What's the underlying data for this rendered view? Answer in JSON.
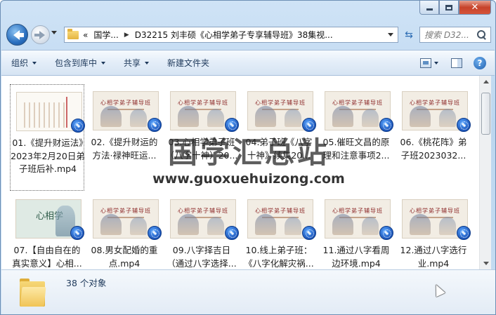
{
  "window": {
    "caption_buttons": {
      "minimize": "minimize-icon",
      "maximize": "maximize-icon",
      "close": "✕"
    }
  },
  "nav": {
    "back_icon": "back-arrow-icon",
    "forward_icon": "forward-arrow-icon",
    "breadcrumb_prefix": "«",
    "breadcrumb": [
      "国学...",
      "D32215 刘丰硕《心相学弟子专享辅导班》38集视..."
    ],
    "refresh_icon": "⇆",
    "search_placeholder": "搜索 D32..."
  },
  "toolbar": {
    "organize": "组织",
    "include_in_library": "包含到库中",
    "share": "共享",
    "new_folder": "新建文件夹"
  },
  "files": [
    {
      "label": "01.《提升财运法》2023年2月20日弟子班后补.mp4",
      "thumb": "doc",
      "selected": true
    },
    {
      "label": "02.《提升财运的方法·禄神旺运...",
      "thumb": "class"
    },
    {
      "label": "03.心相学弟子班（八字十神）20...",
      "thumb": "class"
    },
    {
      "label": "04.弟子班《八字十神》续集20...",
      "thumb": "class"
    },
    {
      "label": "05.催旺文昌的原理和注意事项2...",
      "thumb": "class"
    },
    {
      "label": "06.《桃花阵》弟子班2023032...",
      "thumb": "class"
    },
    {
      "label": "07.【自由自在的真实意义】心相...",
      "thumb": "green"
    },
    {
      "label": "08.男女配婚的重点.mp4",
      "thumb": "class"
    },
    {
      "label": "09.八字择吉日（通过八字选择...",
      "thumb": "class"
    },
    {
      "label": "10.线上弟子班：《八字化解灾祸...",
      "thumb": "class"
    },
    {
      "label": "11.通过八字看周边环境.mp4",
      "thumb": "class"
    },
    {
      "label": "12.通过八字选行业.mp4",
      "thumb": "class"
    }
  ],
  "thumb_text": {
    "class_title": "心相学弟子辅导班",
    "green_title": "心相学"
  },
  "watermark": {
    "title": "国学汇总站",
    "url": "www.guoxuehuizong.com"
  },
  "status": {
    "count": "38 个对象"
  },
  "colors": {
    "accent": "#2a6fbf",
    "toolbar_text": "#1e395b",
    "close": "#c6432b"
  }
}
